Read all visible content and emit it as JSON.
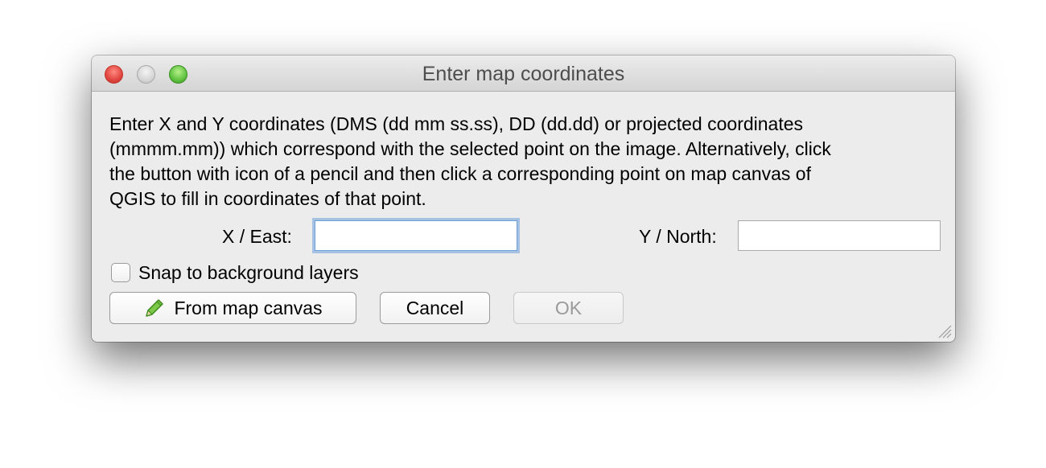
{
  "window": {
    "title": "Enter map coordinates"
  },
  "dialog": {
    "description": "Enter X and Y coordinates (DMS (dd mm ss.ss), DD (dd.dd) or projected coordinates\n(mmmm.mm)) which correspond with the selected point on the image. Alternatively, click\nthe button with icon of a pencil and then click a corresponding point on map canvas of\nQGIS to fill in coordinates of that point.",
    "x_label": "X / East:",
    "x_value": "",
    "y_label": "Y / North:",
    "y_value": "",
    "snap_label": "Snap to background layers",
    "snap_checked": false
  },
  "buttons": {
    "from_map_canvas": "From map canvas",
    "cancel": "Cancel",
    "ok": "OK"
  },
  "icons": {
    "pencil": "pencil-icon"
  },
  "colors": {
    "close": "#e0443e",
    "minimize": "#d6d6d6",
    "zoom": "#5fc240",
    "focus_ring": "#6f9fd8",
    "pencil": "#5fb82b"
  }
}
